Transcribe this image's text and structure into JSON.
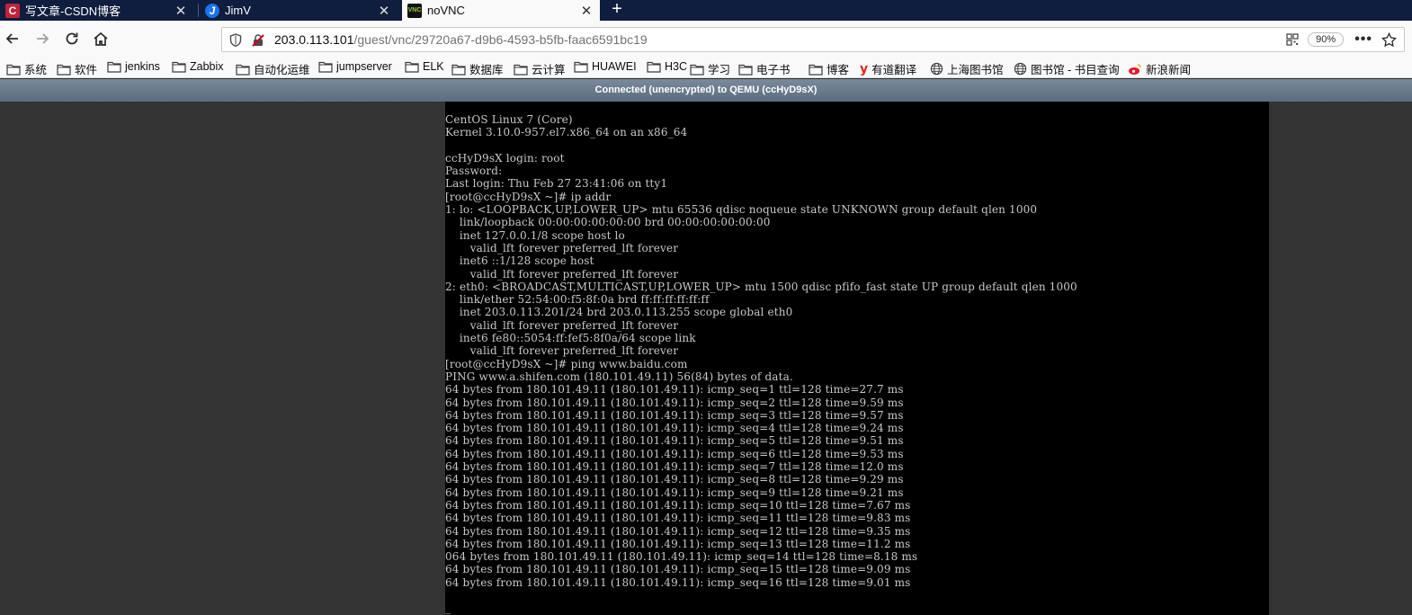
{
  "tabs": [
    {
      "title": "写文章-CSDN博客",
      "icon": "csdn-icon",
      "color": "#c32136"
    },
    {
      "title": "JimV",
      "icon": "jimv-icon",
      "color": "#1a73e8"
    },
    {
      "title": "noVNC",
      "icon": "vnc-icon",
      "color": "#111111",
      "active": true
    }
  ],
  "newtab_label": "+",
  "address": {
    "host": "203.0.113.101",
    "path": "/guest/vnc/29720a67-d9b6-4593-b5fb-faac6591bc19",
    "zoom": "90%"
  },
  "bookmarks": [
    {
      "label": "系统",
      "icon": "folder-icon"
    },
    {
      "label": "软件",
      "icon": "folder-icon"
    },
    {
      "label": "jenkins",
      "icon": "folder-icon"
    },
    {
      "label": "Zabbix",
      "icon": "folder-icon"
    },
    {
      "label": "自动化运维",
      "icon": "folder-icon"
    },
    {
      "label": "jumpserver",
      "icon": "folder-icon"
    },
    {
      "label": "ELK",
      "icon": "folder-icon"
    },
    {
      "label": "数据库",
      "icon": "folder-icon"
    },
    {
      "label": "云计算",
      "icon": "folder-icon"
    },
    {
      "label": "HUAWEI",
      "icon": "folder-icon"
    },
    {
      "label": "H3C",
      "icon": "folder-icon"
    },
    {
      "label": "学习",
      "icon": "folder-icon"
    },
    {
      "label": "电子书",
      "icon": "folder-icon"
    },
    {
      "label": "博客",
      "icon": "folder-icon"
    },
    {
      "label": "有道翻译",
      "icon": "youdao-icon"
    },
    {
      "label": "上海图书馆",
      "icon": "globe-icon"
    },
    {
      "label": "图书馆 - 书目查询",
      "icon": "globe-icon"
    },
    {
      "label": "新浪新闻",
      "icon": "weibo-icon"
    }
  ],
  "vnc_status": "Connected (unencrypted) to QEMU (ccHyD9sX)",
  "terminal_lines": [
    "CentOS Linux 7 (Core)",
    "Kernel 3.10.0-957.el7.x86_64 on an x86_64",
    "",
    "ccHyD9sX login: root",
    "Password:",
    "Last login: Thu Feb 27 23:41:06 on tty1",
    "[root@ccHyD9sX ~]# ip addr",
    "1: lo: <LOOPBACK,UP,LOWER_UP> mtu 65536 qdisc noqueue state UNKNOWN group default qlen 1000",
    "    link/loopback 00:00:00:00:00:00 brd 00:00:00:00:00:00",
    "    inet 127.0.0.1/8 scope host lo",
    "       valid_lft forever preferred_lft forever",
    "    inet6 ::1/128 scope host",
    "       valid_lft forever preferred_lft forever",
    "2: eth0: <BROADCAST,MULTICAST,UP,LOWER_UP> mtu 1500 qdisc pfifo_fast state UP group default qlen 1000",
    "    link/ether 52:54:00:f5:8f:0a brd ff:ff:ff:ff:ff:ff",
    "    inet 203.0.113.201/24 brd 203.0.113.255 scope global eth0",
    "       valid_lft forever preferred_lft forever",
    "    inet6 fe80::5054:ff:fef5:8f0a/64 scope link",
    "       valid_lft forever preferred_lft forever",
    "[root@ccHyD9sX ~]# ping www.baidu.com",
    "PING www.a.shifen.com (180.101.49.11) 56(84) bytes of data.",
    "64 bytes from 180.101.49.11 (180.101.49.11): icmp_seq=1 ttl=128 time=27.7 ms",
    "64 bytes from 180.101.49.11 (180.101.49.11): icmp_seq=2 ttl=128 time=9.59 ms",
    "64 bytes from 180.101.49.11 (180.101.49.11): icmp_seq=3 ttl=128 time=9.57 ms",
    "64 bytes from 180.101.49.11 (180.101.49.11): icmp_seq=4 ttl=128 time=9.24 ms",
    "64 bytes from 180.101.49.11 (180.101.49.11): icmp_seq=5 ttl=128 time=9.51 ms",
    "64 bytes from 180.101.49.11 (180.101.49.11): icmp_seq=6 ttl=128 time=9.53 ms",
    "64 bytes from 180.101.49.11 (180.101.49.11): icmp_seq=7 ttl=128 time=12.0 ms",
    "64 bytes from 180.101.49.11 (180.101.49.11): icmp_seq=8 ttl=128 time=9.29 ms",
    "64 bytes from 180.101.49.11 (180.101.49.11): icmp_seq=9 ttl=128 time=9.21 ms",
    "64 bytes from 180.101.49.11 (180.101.49.11): icmp_seq=10 ttl=128 time=7.67 ms",
    "64 bytes from 180.101.49.11 (180.101.49.11): icmp_seq=11 ttl=128 time=9.83 ms",
    "64 bytes from 180.101.49.11 (180.101.49.11): icmp_seq=12 ttl=128 time=9.35 ms",
    "64 bytes from 180.101.49.11 (180.101.49.11): icmp_seq=13 ttl=128 time=11.2 ms",
    "064 bytes from 180.101.49.11 (180.101.49.11): icmp_seq=14 ttl=128 time=8.18 ms",
    "64 bytes from 180.101.49.11 (180.101.49.11): icmp_seq=15 ttl=128 time=9.09 ms",
    "64 bytes from 180.101.49.11 (180.101.49.11): icmp_seq=16 ttl=128 time=9.01 ms",
    "",
    "_"
  ]
}
